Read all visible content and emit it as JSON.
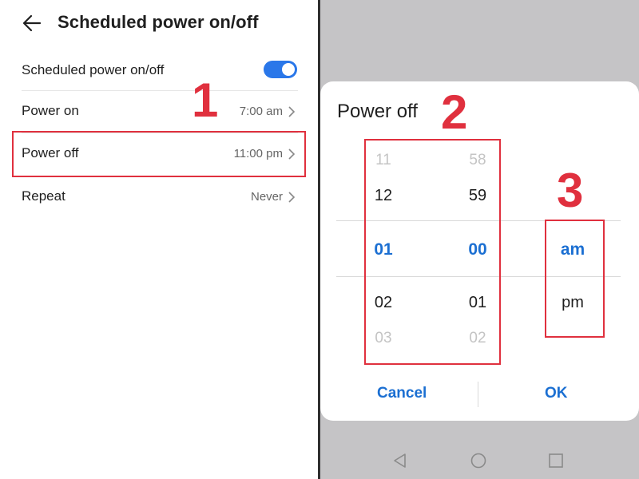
{
  "settings": {
    "title": "Scheduled power on/off",
    "rows": [
      {
        "label": "Scheduled power on/off",
        "value": ""
      },
      {
        "label": "Power on",
        "value": "7:00 am"
      },
      {
        "label": "Power off",
        "value": "11:00 pm"
      },
      {
        "label": "Repeat",
        "value": "Never"
      }
    ]
  },
  "callouts": [
    "1",
    "2",
    "3"
  ],
  "dialog": {
    "title": "Power off",
    "hours": [
      "11",
      "12",
      "01",
      "02",
      "03"
    ],
    "minutes": [
      "58",
      "59",
      "00",
      "01",
      "02"
    ],
    "ampm": [
      "am",
      "pm"
    ],
    "selected": {
      "hour": "01",
      "minute": "00",
      "ampm": "am"
    },
    "cancel_label": "Cancel",
    "ok_label": "OK"
  },
  "colors": {
    "accent": "#1b6fd2",
    "toggle_on": "#2a77e9",
    "callout": "#e0303e",
    "overlay": "#c5c4c6"
  },
  "icons": {
    "back": "arrow-left-icon",
    "chevron": "chevron-right-icon",
    "nav_back": "triangle-back-icon",
    "nav_home": "circle-home-icon",
    "nav_recents": "square-recents-icon"
  }
}
